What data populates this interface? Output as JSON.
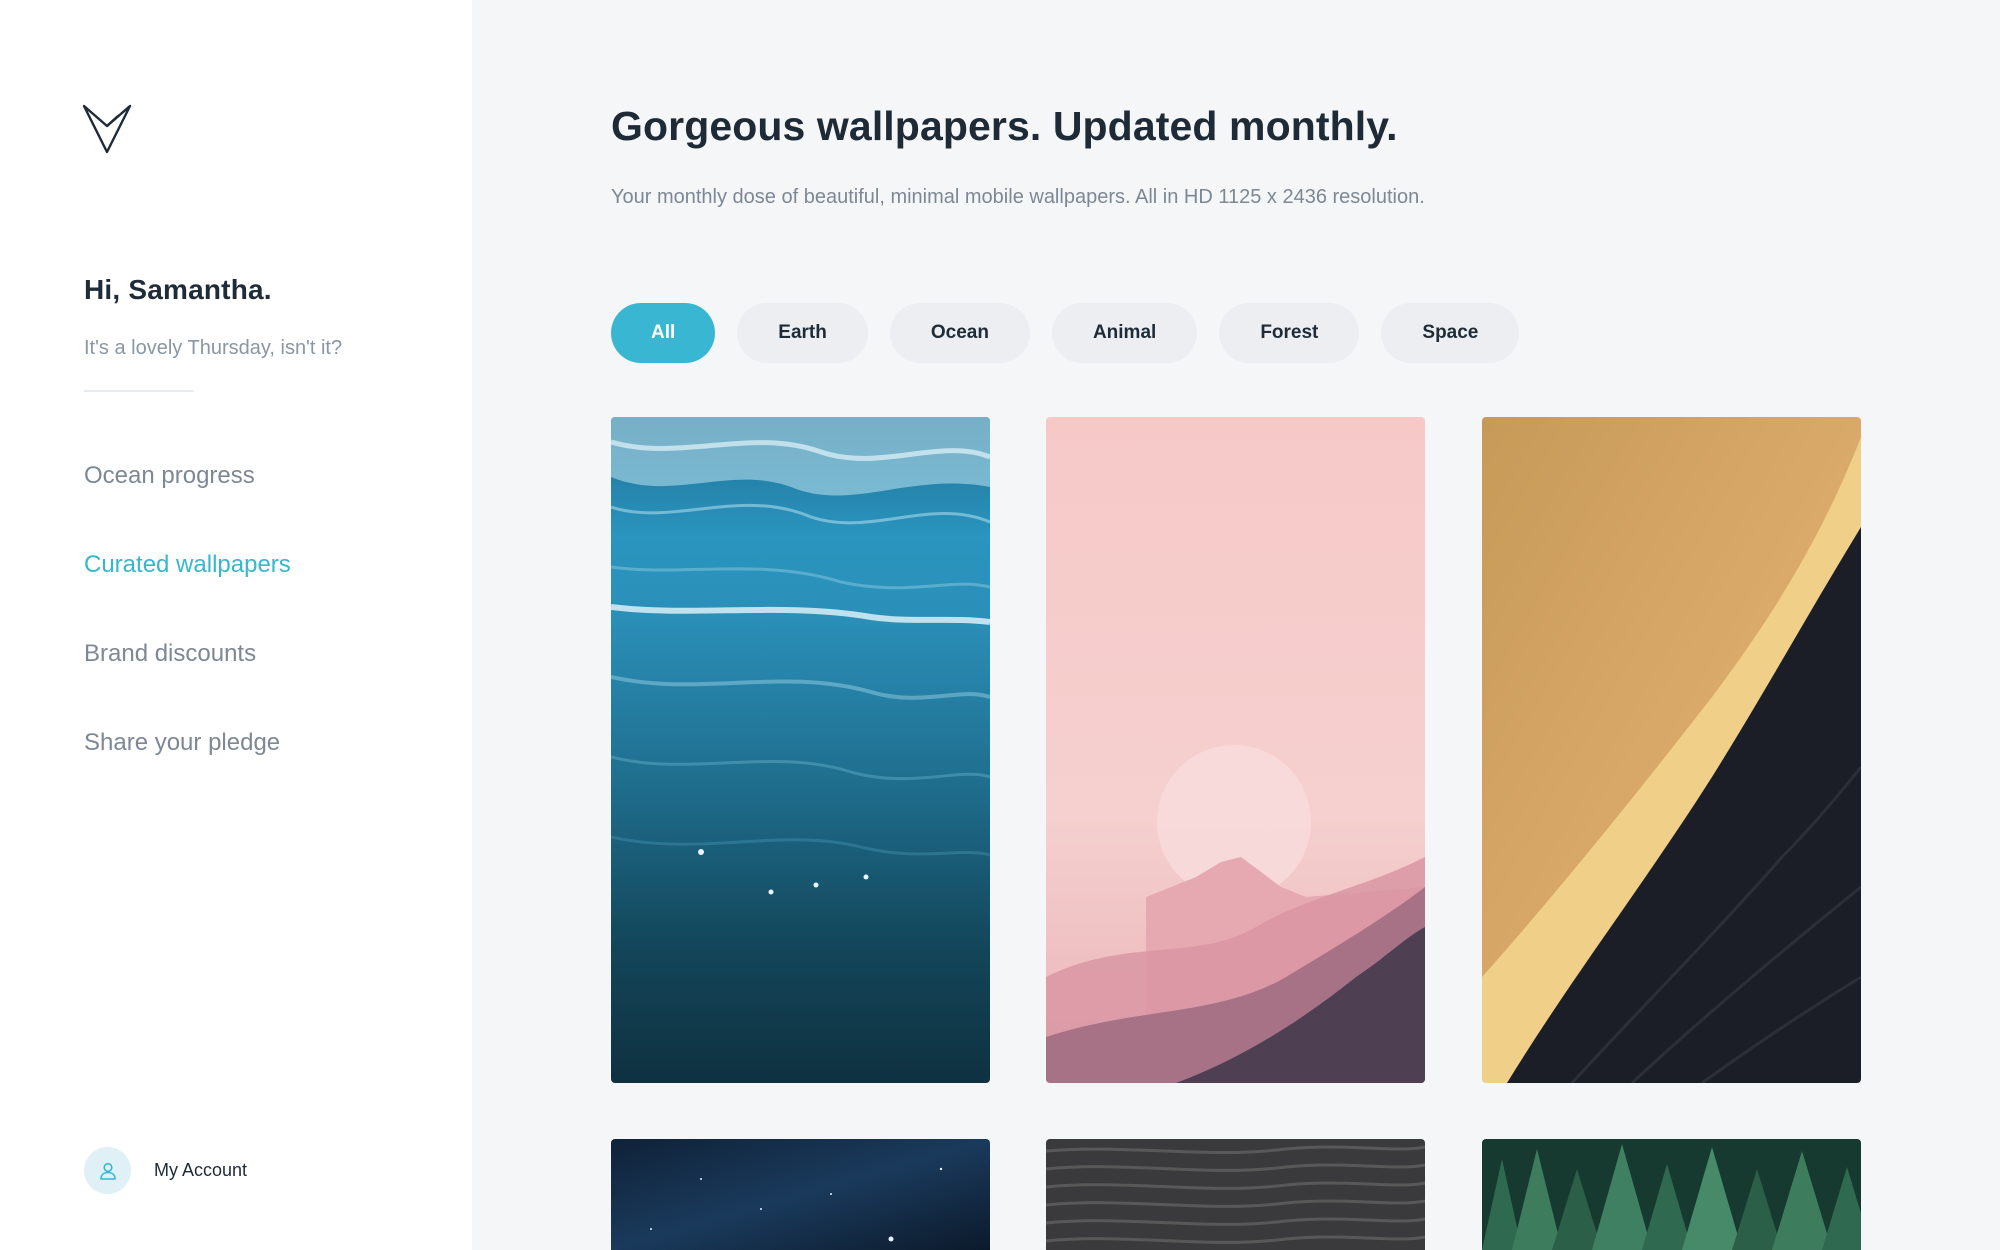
{
  "sidebar": {
    "greeting": "Hi, Samantha.",
    "subgreeting": "It's a lovely Thursday, isn't it?",
    "nav": [
      {
        "label": "Ocean progress",
        "active": false
      },
      {
        "label": "Curated wallpapers",
        "active": true
      },
      {
        "label": "Brand discounts",
        "active": false
      },
      {
        "label": "Share your pledge",
        "active": false
      }
    ],
    "account_label": "My Account"
  },
  "main": {
    "headline": "Gorgeous wallpapers. Updated monthly.",
    "subheadline": "Your monthly dose of beautiful, minimal mobile wallpapers. All in HD 1125 x 2436 resolution.",
    "filters": [
      "All",
      "Earth",
      "Ocean",
      "Animal",
      "Forest",
      "Space"
    ],
    "active_filter": "All",
    "wallpapers": [
      {
        "theme": "ocean-waves"
      },
      {
        "theme": "pink-moon-mountains"
      },
      {
        "theme": "desert-dune"
      },
      {
        "theme": "starry-space"
      },
      {
        "theme": "dark-sand-ripples"
      },
      {
        "theme": "pine-forest"
      }
    ]
  },
  "colors": {
    "accent": "#39b7d2",
    "text_dark": "#1f2b37",
    "text_muted": "#7d8894",
    "sidebar_bg": "#ffffff",
    "main_bg": "#f5f6f8"
  },
  "icons": [
    "logo-icon",
    "user-icon"
  ]
}
